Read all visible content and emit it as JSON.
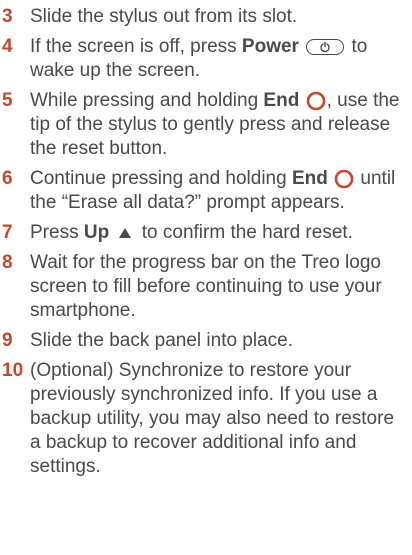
{
  "steps": [
    {
      "num": "3",
      "text": "Slide the stylus out from its slot."
    },
    {
      "num": "4",
      "t1": "If the screen is off, press ",
      "key": "Power",
      "t2": " to wake up the screen."
    },
    {
      "num": "5",
      "t1": "While pressing and holding ",
      "key": "End",
      "t2": ", use the tip of the stylus to gently press and release the reset button."
    },
    {
      "num": "6",
      "t1": "Continue pressing and holding ",
      "key": "End",
      "t2": " until the “Erase all data?” prompt appears."
    },
    {
      "num": "7",
      "t1": "Press ",
      "key": "Up",
      "t2": " to confirm the hard reset."
    },
    {
      "num": "8",
      "text": "Wait for the progress bar on the Treo logo screen to fill before continuing to use your smartphone."
    },
    {
      "num": "9",
      "text": "Slide the back panel into place."
    },
    {
      "num": "10",
      "text": "(Optional) Synchronize to restore your previously synchronized info. If you use a backup utility, you may also need to restore a backup to recover additional info and settings."
    }
  ],
  "icons": {
    "power": "power-icon",
    "end": "end-icon",
    "up": "up-arrow-icon"
  },
  "colors": {
    "step_number": "#c8462e",
    "end_icon": "#c8462e",
    "text": "#4a4a4a"
  }
}
